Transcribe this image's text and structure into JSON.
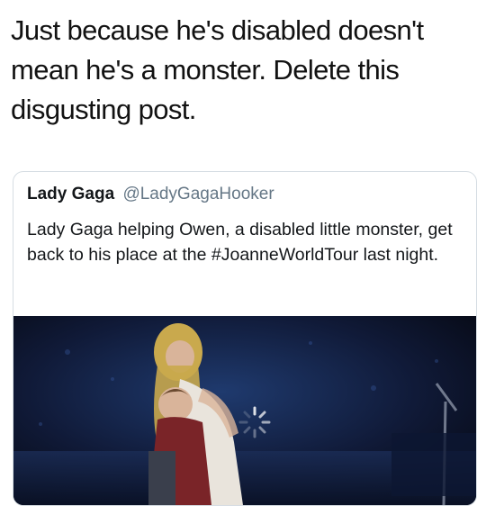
{
  "post": {
    "text": "Just because he's disabled doesn't mean he's a monster. Delete this disgusting post."
  },
  "quoted_tweet": {
    "display_name": "Lady Gaga",
    "handle": "@LadyGagaHooker",
    "text": "Lady Gaga helping Owen, a disabled little monster, get back to his place at the #JoanneWorldTour last night.",
    "media": {
      "type": "video-still",
      "loading_indicator": "spinner-icon",
      "colors": {
        "stage_dark": "#0b1020",
        "stage_blue": "#1f3a6e",
        "hair_blonde": "#c9a94d",
        "skin": "#d9b49a",
        "outfit_white": "#e9e4dc",
        "child_red": "#7a2428"
      }
    }
  }
}
